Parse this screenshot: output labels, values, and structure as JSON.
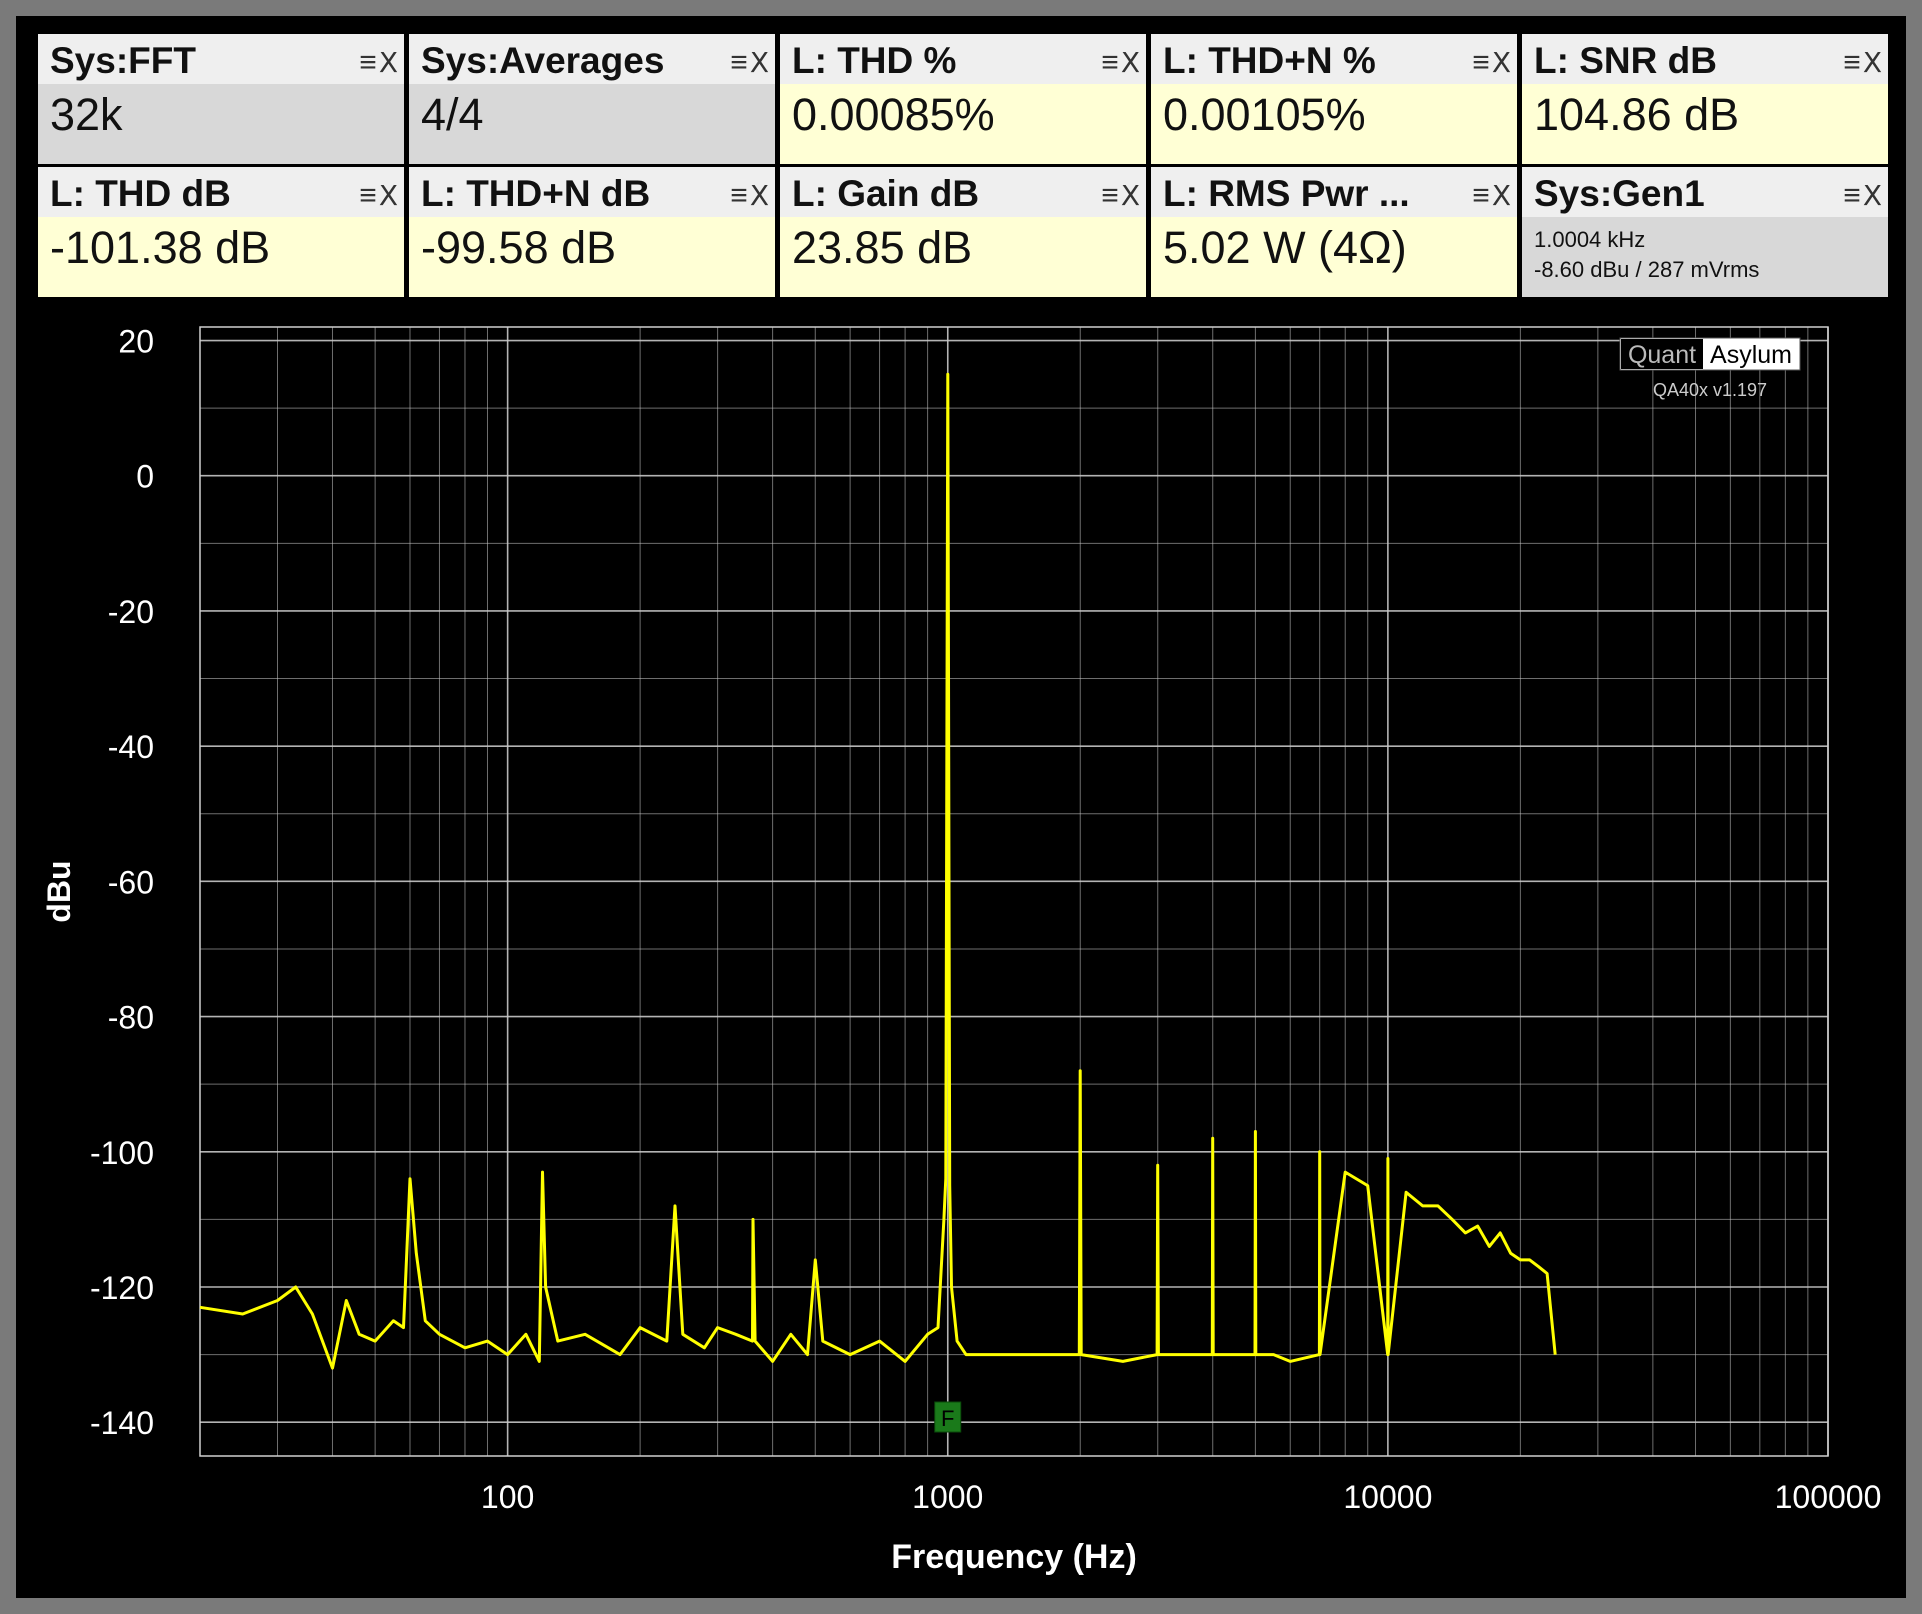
{
  "tiles": [
    {
      "title": "Sys:FFT",
      "value": "32k",
      "bg": "gray"
    },
    {
      "title": "Sys:Averages",
      "value": "4/4",
      "bg": "gray"
    },
    {
      "title": "L: THD %",
      "value": "0.00085%",
      "bg": "yellow"
    },
    {
      "title": "L: THD+N %",
      "value": "0.00105%",
      "bg": "yellow"
    },
    {
      "title": "L: SNR dB",
      "value": "104.86 dB",
      "bg": "yellow"
    },
    {
      "title": "L: THD dB",
      "value": "-101.38 dB",
      "bg": "yellow"
    },
    {
      "title": "L: THD+N dB",
      "value": "-99.58 dB",
      "bg": "yellow"
    },
    {
      "title": "L: Gain dB",
      "value": "23.85 dB",
      "bg": "yellow"
    },
    {
      "title": "L: RMS Pwr ...",
      "value": "5.02 W (4Ω)",
      "bg": "yellow"
    },
    {
      "title": "Sys:Gen1",
      "value_line1": "1.0004 kHz",
      "value_line2": "-8.60 dBu  / 287 mVrms",
      "bg": "gray"
    }
  ],
  "tile_controls": {
    "menu": "≡",
    "close": "X"
  },
  "watermark": {
    "quant": "Quant",
    "asylum": "Asylum",
    "version": "QA40x v1.197"
  },
  "marker_label": "F",
  "colors": {
    "trace": "#ffff00",
    "grid": "#c8c8c8",
    "marker": "#1a7a1a"
  },
  "chart_data": {
    "type": "line",
    "xscale": "log",
    "xlabel": "Frequency (Hz)",
    "ylabel": "dBu",
    "xlim": [
      20,
      100000
    ],
    "ylim": [
      -145,
      22
    ],
    "xticks": [
      100,
      1000,
      10000,
      100000
    ],
    "xtick_labels": [
      "100",
      "1000",
      "10000",
      "100000"
    ],
    "yticks": [
      20,
      0,
      -20,
      -40,
      -60,
      -80,
      -100,
      -120,
      -140
    ],
    "ytick_labels": [
      "20",
      "0",
      "-20",
      "-40",
      "-60",
      "-80",
      "-100",
      "-120",
      "-140"
    ],
    "grid": true,
    "series": [
      {
        "x": [
          20,
          25,
          30,
          33,
          36,
          40,
          43,
          46,
          50,
          55,
          58,
          60,
          62,
          65,
          70,
          80,
          90,
          100,
          110,
          118,
          120,
          122,
          130,
          150,
          180,
          200,
          230,
          240,
          250,
          280,
          300,
          330,
          360,
          361,
          365,
          400,
          440,
          480,
          500,
          520,
          600,
          700,
          800,
          900,
          950,
          980,
          990,
          1000,
          1010,
          1020,
          1050,
          1100,
          1300,
          1600,
          1990,
          2000,
          2010,
          2500,
          2990,
          3000,
          3010,
          3500,
          3990,
          4000,
          4010,
          4500,
          4990,
          5000,
          5010,
          5500,
          6000,
          6990,
          7000,
          7010,
          8000,
          9000,
          9990,
          10000,
          10010,
          11000,
          12000,
          13000,
          14000,
          15000,
          16000,
          17000,
          18000,
          19000,
          20000,
          21000,
          22000,
          23000,
          24000
        ],
        "y": [
          -123,
          -124,
          -122,
          -120,
          -124,
          -132,
          -122,
          -127,
          -128,
          -125,
          -126,
          -104,
          -115,
          -125,
          -127,
          -129,
          -128,
          -130,
          -127,
          -131,
          -103,
          -120,
          -128,
          -127,
          -130,
          -126,
          -128,
          -108,
          -127,
          -129,
          -126,
          -127,
          -128,
          -110,
          -128,
          -131,
          -127,
          -130,
          -116,
          -128,
          -130,
          -128,
          -131,
          -127,
          -126,
          -110,
          -104,
          15,
          -105,
          -120,
          -128,
          -130,
          -130,
          -130,
          -130,
          -88,
          -130,
          -131,
          -130,
          -102,
          -130,
          -130,
          -130,
          -98,
          -130,
          -130,
          -130,
          -97,
          -130,
          -130,
          -131,
          -130,
          -100,
          -130,
          -103,
          -105,
          -130,
          -101,
          -130,
          -106,
          -108,
          -108,
          -110,
          -112,
          -111,
          -114,
          -112,
          -115,
          -116,
          -116,
          -117,
          -118,
          -130
        ]
      }
    ]
  }
}
